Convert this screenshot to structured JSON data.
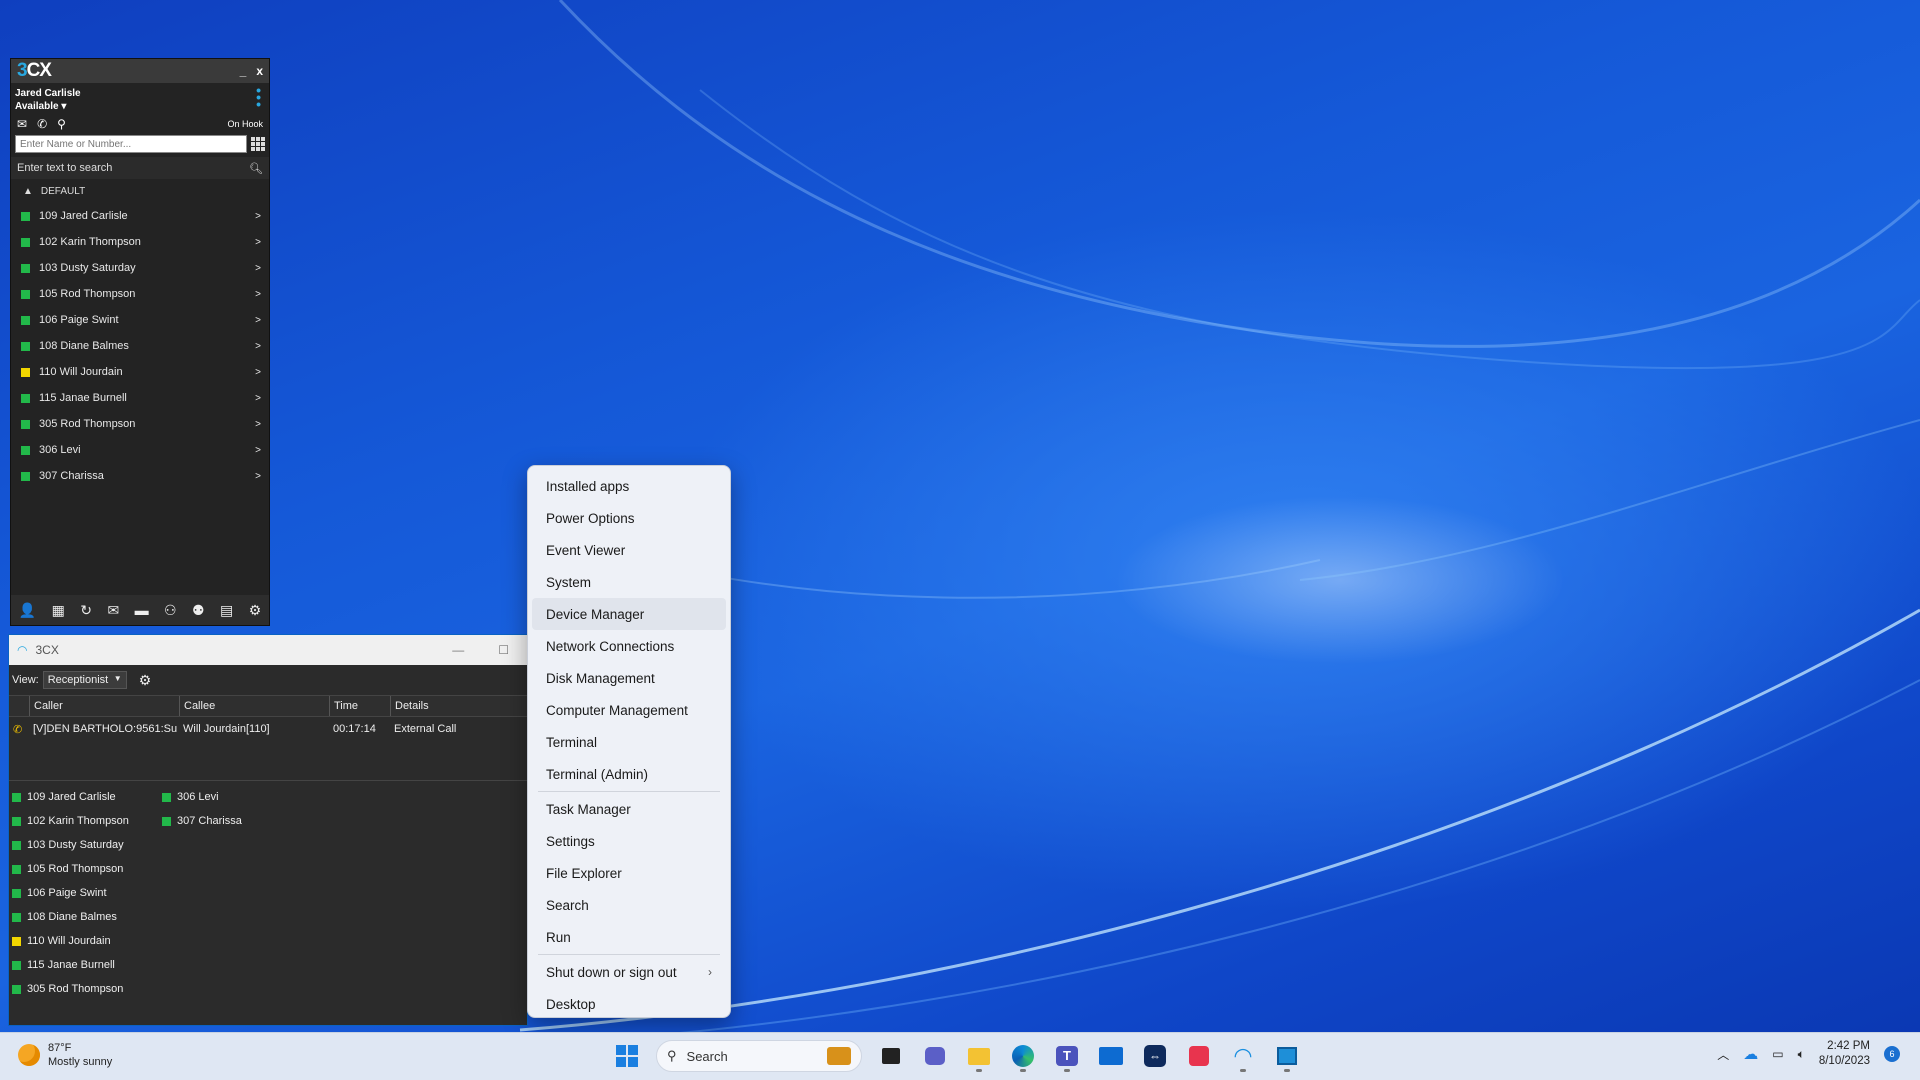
{
  "phone": {
    "app_name": "3CX",
    "minimize": "_",
    "close": "x",
    "user_name": "Jared Carlisle",
    "status": "Available",
    "hook_status": "On Hook",
    "dial_placeholder": "Enter Name or Number...",
    "search_text": "Enter text to search",
    "group_name": "DEFAULT",
    "contacts": [
      {
        "label": "109 Jared Carlisle",
        "status_color": "#22b84a"
      },
      {
        "label": "102 Karin Thompson",
        "status_color": "#22b84a"
      },
      {
        "label": "103 Dusty Saturday",
        "status_color": "#22b84a"
      },
      {
        "label": "105 Rod Thompson",
        "status_color": "#22b84a"
      },
      {
        "label": "106 Paige Swint",
        "status_color": "#22b84a"
      },
      {
        "label": "108 Diane Balmes",
        "status_color": "#22b84a"
      },
      {
        "label": "110 Will Jourdain",
        "status_color": "#f2d600"
      },
      {
        "label": "115 Janae Burnell",
        "status_color": "#22b84a"
      },
      {
        "label": "305 Rod Thompson",
        "status_color": "#22b84a"
      },
      {
        "label": "306 Levi",
        "status_color": "#22b84a"
      },
      {
        "label": "307 Charissa",
        "status_color": "#22b84a"
      }
    ],
    "bottom_icons": [
      "contacts-icon",
      "dialpad-icon",
      "history-icon",
      "voicemail-icon",
      "chat-icon",
      "conference-icon",
      "group-icon",
      "panel-icon",
      "settings-icon"
    ]
  },
  "assistant": {
    "title": "3CX",
    "view_label": "View:",
    "view_value": "Receptionist",
    "columns": [
      "Caller",
      "Callee",
      "Time",
      "Details"
    ],
    "calls": [
      {
        "caller": "[V]DEN BARTHOLO:9561:Su",
        "callee": "Will Jourdain[110]",
        "time": "00:17:14",
        "details": "External Call"
      }
    ],
    "extensions": [
      {
        "label": "109 Jared Carlisle",
        "status_color": "#22b84a"
      },
      {
        "label": "102 Karin Thompson",
        "status_color": "#22b84a"
      },
      {
        "label": "103 Dusty Saturday",
        "status_color": "#22b84a"
      },
      {
        "label": "105 Rod Thompson",
        "status_color": "#22b84a"
      },
      {
        "label": "106 Paige Swint",
        "status_color": "#22b84a"
      },
      {
        "label": "108 Diane Balmes",
        "status_color": "#22b84a"
      },
      {
        "label": "110 Will Jourdain",
        "status_color": "#f2d600"
      },
      {
        "label": "115 Janae Burnell",
        "status_color": "#22b84a"
      },
      {
        "label": "305 Rod Thompson",
        "status_color": "#22b84a"
      },
      {
        "label": "306 Levi",
        "status_color": "#22b84a"
      },
      {
        "label": "307 Charissa",
        "status_color": "#22b84a"
      }
    ]
  },
  "context_menu": {
    "groups": [
      [
        "Installed apps",
        "Power Options",
        "Event Viewer",
        "System",
        "Device Manager",
        "Network Connections",
        "Disk Management",
        "Computer Management",
        "Terminal",
        "Terminal (Admin)"
      ],
      [
        "Task Manager",
        "Settings",
        "File Explorer",
        "Search",
        "Run"
      ],
      [
        "Shut down or sign out",
        "Desktop"
      ]
    ],
    "highlighted": "Device Manager",
    "submenu_item": "Shut down or sign out"
  },
  "taskbar": {
    "weather_temp": "87°F",
    "weather_desc": "Mostly sunny",
    "search_label": "Search",
    "apps": [
      "task-view-icon",
      "teams-chat-icon",
      "file-explorer-icon",
      "edge-icon",
      "teams-icon",
      "mail-icon",
      "teamviewer-icon",
      "pdf-icon",
      "3cx-icon",
      "app-icon"
    ],
    "time": "2:42 PM",
    "date": "8/10/2023",
    "notifications": "6"
  }
}
